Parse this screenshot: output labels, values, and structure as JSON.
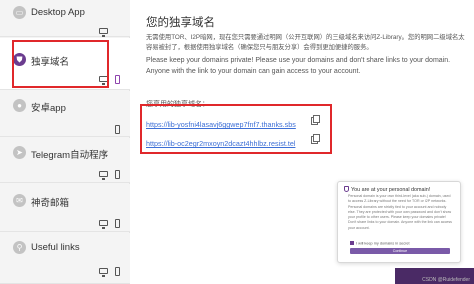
{
  "sidebar": {
    "items": [
      {
        "label": "Desktop App",
        "icon": "monitor-icon",
        "active": false
      },
      {
        "label": "独享域名",
        "icon": "shield-icon",
        "active": true
      },
      {
        "label": "安卓app",
        "icon": "android-icon",
        "active": false
      },
      {
        "label": "Telegram自动程序",
        "icon": "telegram-icon",
        "active": false
      },
      {
        "label": "神奇邮箱",
        "icon": "mail-icon",
        "active": false
      },
      {
        "label": "Useful links",
        "icon": "link-icon",
        "active": false
      }
    ]
  },
  "main": {
    "title": "您的独享域名",
    "desc_zh": "无需使用TOR、I2P暗网，现在您只需要通过明网（公开互联网）的三级域名来访问Z-Library。您的明网二级域名太容易被封了，根据使用独享域名（确保您只与朋友分享）会得到更加便捷的服务。",
    "desc_en": "Please keep your domains private! Please use your domains and don't share links to your domain. Anyone with the link to your domain can gain access to your account.",
    "links_label": "您享用的独享域名：",
    "domains": [
      "https://lib-yosfni4lasavj6ggwep7fnf7.thanks.sbs",
      "https://lib-oc2egr2mxoyn2dcazt4hhlbz.resist.tel"
    ]
  },
  "popup": {
    "title": "You are at your personal domain!",
    "body": "Personal domain is your own third-level (aka sub-) domain, used to access Z-Library without the need for TOR or I2P networks. Personal domains are strictly tied to your account and nobody else. They are protected with your own password and don't show your profile to other users. Please keep your domains private! Don't share links to your domain. Anyone with the link can access your account.",
    "checkbox_label": "I will keep my domains in secret",
    "button_label": "Continue"
  },
  "watermark": "CSDN @Ruidefender",
  "colors": {
    "accent": "#6b3c8f",
    "highlight": "#e0282b",
    "link": "#3d6fd6"
  }
}
